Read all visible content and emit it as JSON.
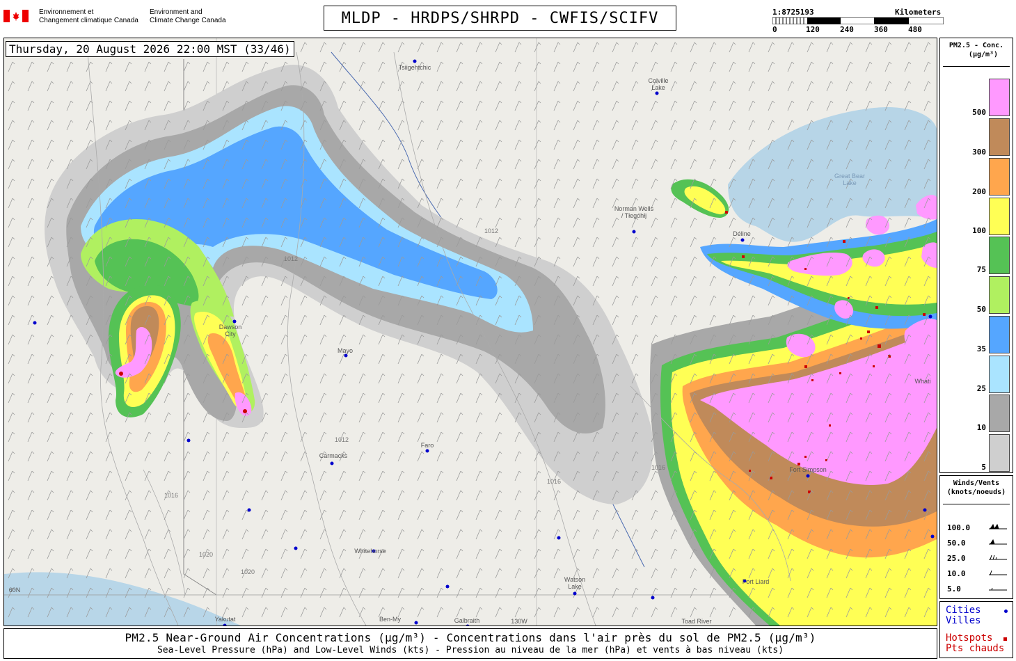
{
  "header": {
    "agency_fr_line1": "Environnement et",
    "agency_fr_line2": "Changement climatique Canada",
    "agency_en_line1": "Environment and",
    "agency_en_line2": "Climate Change Canada",
    "title": "MLDP - HRDPS/SHRPD - CWFIS/SCIFV",
    "scale_ratio": "1:8725193",
    "scale_units": "Kilometers",
    "scale_ticks": [
      "0",
      "120",
      "240",
      "360",
      "480"
    ]
  },
  "map": {
    "timestamp": "Thursday, 20 August 2026 22:00 MST (33/46)",
    "cities": [
      {
        "name": "Tsiigehtchic"
      },
      {
        "name": "Colville Lake"
      },
      {
        "name": "Norman Wells / Tłegóhłį"
      },
      {
        "name": "Great Bear Lake"
      },
      {
        "name": "Déline"
      },
      {
        "name": "Dawson City"
      },
      {
        "name": "Mayo"
      },
      {
        "name": "Faro"
      },
      {
        "name": "Carmacks"
      },
      {
        "name": "Whitehorse"
      },
      {
        "name": "Watson Lake"
      },
      {
        "name": "Fort Simpson"
      },
      {
        "name": "Fort Liard"
      },
      {
        "name": "Whati"
      },
      {
        "name": "Yakutat"
      },
      {
        "name": "Ben-My"
      },
      {
        "name": "Galbraith"
      },
      {
        "name": "Toad River"
      },
      {
        "name": "130W"
      },
      {
        "name": "60N"
      }
    ],
    "isobar_labels": [
      "1012",
      "1016",
      "1020"
    ]
  },
  "legend_pm": {
    "title_line1": "PM2.5 - Conc.",
    "title_line2": "(µg/m³)",
    "bins": [
      {
        "label": "500",
        "color": "#ff99ff"
      },
      {
        "label": "300",
        "color": "#c08a5a"
      },
      {
        "label": "200",
        "color": "#ffa64d"
      },
      {
        "label": "100",
        "color": "#ffff55"
      },
      {
        "label": "75",
        "color": "#55c255"
      },
      {
        "label": "50",
        "color": "#b0f060"
      },
      {
        "label": "35",
        "color": "#55a6ff"
      },
      {
        "label": "25",
        "color": "#aae4ff"
      },
      {
        "label": "10",
        "color": "#a8a8a8"
      },
      {
        "label": "5",
        "color": "#cfcfcf"
      }
    ]
  },
  "legend_wind": {
    "title_line1": "Winds/Vents",
    "title_line2": "(knots/noeuds)",
    "items": [
      "100.0",
      "50.0",
      "25.0",
      "10.0",
      "5.0"
    ]
  },
  "legend_points": {
    "cities_en": "Cities",
    "cities_fr": "Villes",
    "hotspots_en": "Hotspots",
    "hotspots_fr": "Pts chauds",
    "city_color": "#0000cc",
    "hotspot_color": "#cc0000"
  },
  "footer": {
    "line1": "PM2.5 Near-Ground Air Concentrations (µg/m³) - Concentrations dans l'air près du sol de PM2.5 (µg/m³)",
    "line2": "Sea-Level Pressure (hPa) and Low-Level Winds (kts) - Pression au niveau de la mer (hPa) et vents à bas niveau (kts)"
  }
}
